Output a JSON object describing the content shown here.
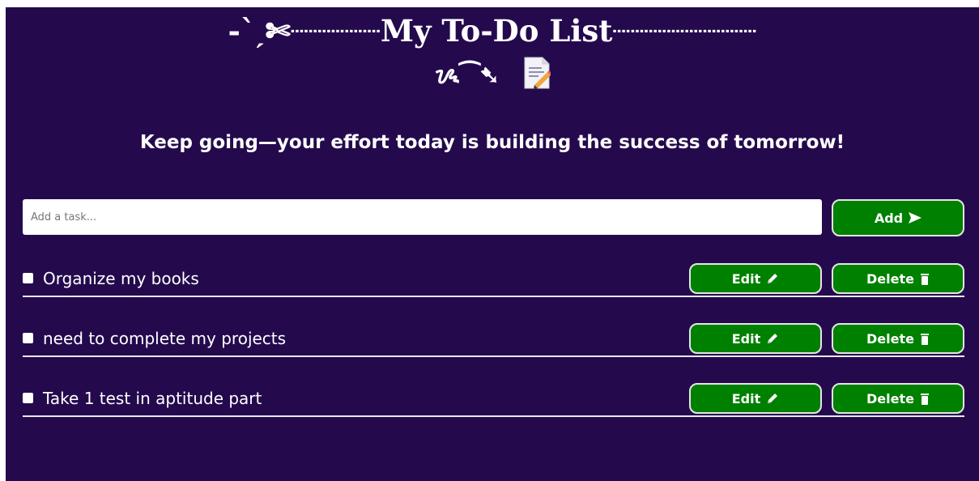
{
  "header": {
    "title_line1": "-`ˏ✄┈┈┈┈┈My To-Do List┈┈┈┈┈┈┈┈",
    "title_line2": "ᝰ⁀➷"
  },
  "motivation": "Keep going—your effort today is building the success of tomorrow!",
  "input": {
    "placeholder": "Add a task...",
    "value": ""
  },
  "add_button": {
    "label": "Add",
    "icon": "send-arrow-icon"
  },
  "tasks": [
    {
      "text": "Organize my books",
      "checked": false,
      "edit_label": "Edit",
      "delete_label": "Delete"
    },
    {
      "text": "need to complete my projects",
      "checked": false,
      "edit_label": "Edit",
      "delete_label": "Delete"
    },
    {
      "text": "Take 1 test in aptitude part",
      "checked": false,
      "edit_label": "Edit",
      "delete_label": "Delete"
    }
  ],
  "icons": {
    "edit": "pencil-icon",
    "delete": "trash-icon",
    "header": "notepad-icon"
  },
  "colors": {
    "background": "#240a4d",
    "button": "#008000",
    "button_border": "#e6e6e6",
    "text": "#ffffff"
  }
}
